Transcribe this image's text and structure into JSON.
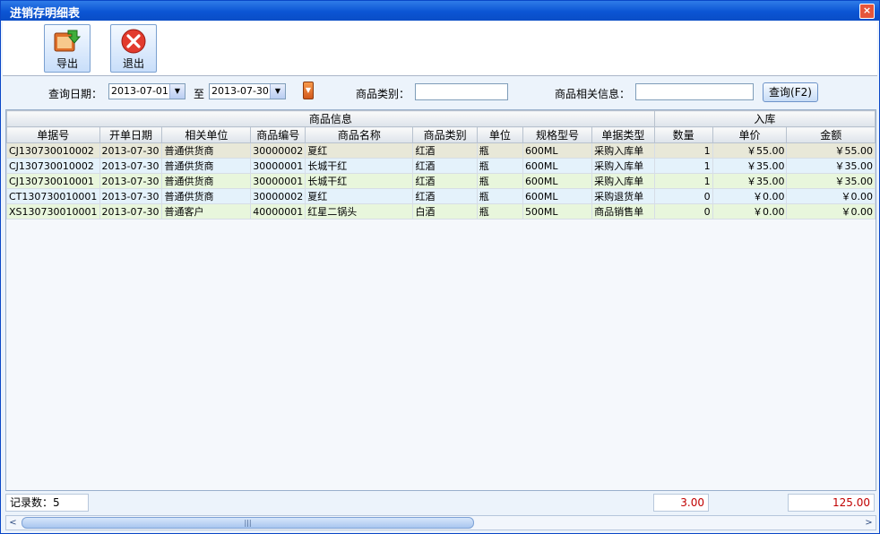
{
  "window": {
    "title": "进销存明细表",
    "close_glyph": "×"
  },
  "toolbar": {
    "export_label": "导出",
    "export_icon": "export-icon",
    "exit_label": "退出",
    "exit_icon": "exit-icon"
  },
  "filter": {
    "date_label": "查询日期：",
    "date_from": "2013-07-01",
    "to_label": "至",
    "date_to": "2013-07-30",
    "category_label": "商品类别：",
    "category_value": "",
    "info_label": "商品相关信息：",
    "info_value": "",
    "query_label": "查询(F2)"
  },
  "table": {
    "groups": [
      {
        "label": "商品信息"
      },
      {
        "label": "入库"
      }
    ],
    "columns": [
      "单据号",
      "开单日期",
      "相关单位",
      "商品编号",
      "商品名称",
      "商品类别",
      "单位",
      "规格型号",
      "单据类型",
      "数量",
      "单价",
      "金额"
    ],
    "rows": [
      [
        "CJ130730010002",
        "2013-07-30",
        "普通供货商",
        "30000002",
        "夏红",
        "红酒",
        "瓶",
        "600ML",
        "采购入库单",
        "1",
        "￥55.00",
        "￥55.00"
      ],
      [
        "CJ130730010002",
        "2013-07-30",
        "普通供货商",
        "30000001",
        "长城干红",
        "红酒",
        "瓶",
        "600ML",
        "采购入库单",
        "1",
        "￥35.00",
        "￥35.00"
      ],
      [
        "CJ130730010001",
        "2013-07-30",
        "普通供货商",
        "30000001",
        "长城干红",
        "红酒",
        "瓶",
        "600ML",
        "采购入库单",
        "1",
        "￥35.00",
        "￥35.00"
      ],
      [
        "CT130730010001",
        "2013-07-30",
        "普通供货商",
        "30000002",
        "夏红",
        "红酒",
        "瓶",
        "600ML",
        "采购退货单",
        "0",
        "￥0.00",
        "￥0.00"
      ],
      [
        "XS130730010001",
        "2013-07-30",
        "普通客户",
        "40000001",
        "红星二锅头",
        "白酒",
        "瓶",
        "500ML",
        "商品销售单",
        "0",
        "￥0.00",
        "￥0.00"
      ]
    ]
  },
  "footer": {
    "record_label": "记录数：5",
    "qty_total": "3.00",
    "amount_total": "125.00"
  },
  "scrollbar": {
    "left_arrow": "<",
    "right_arrow": ">",
    "grip": "|||"
  },
  "colors": {
    "title_bar": "#0b55d4",
    "total_text": "#c00000",
    "close_button": "#e4553c"
  }
}
